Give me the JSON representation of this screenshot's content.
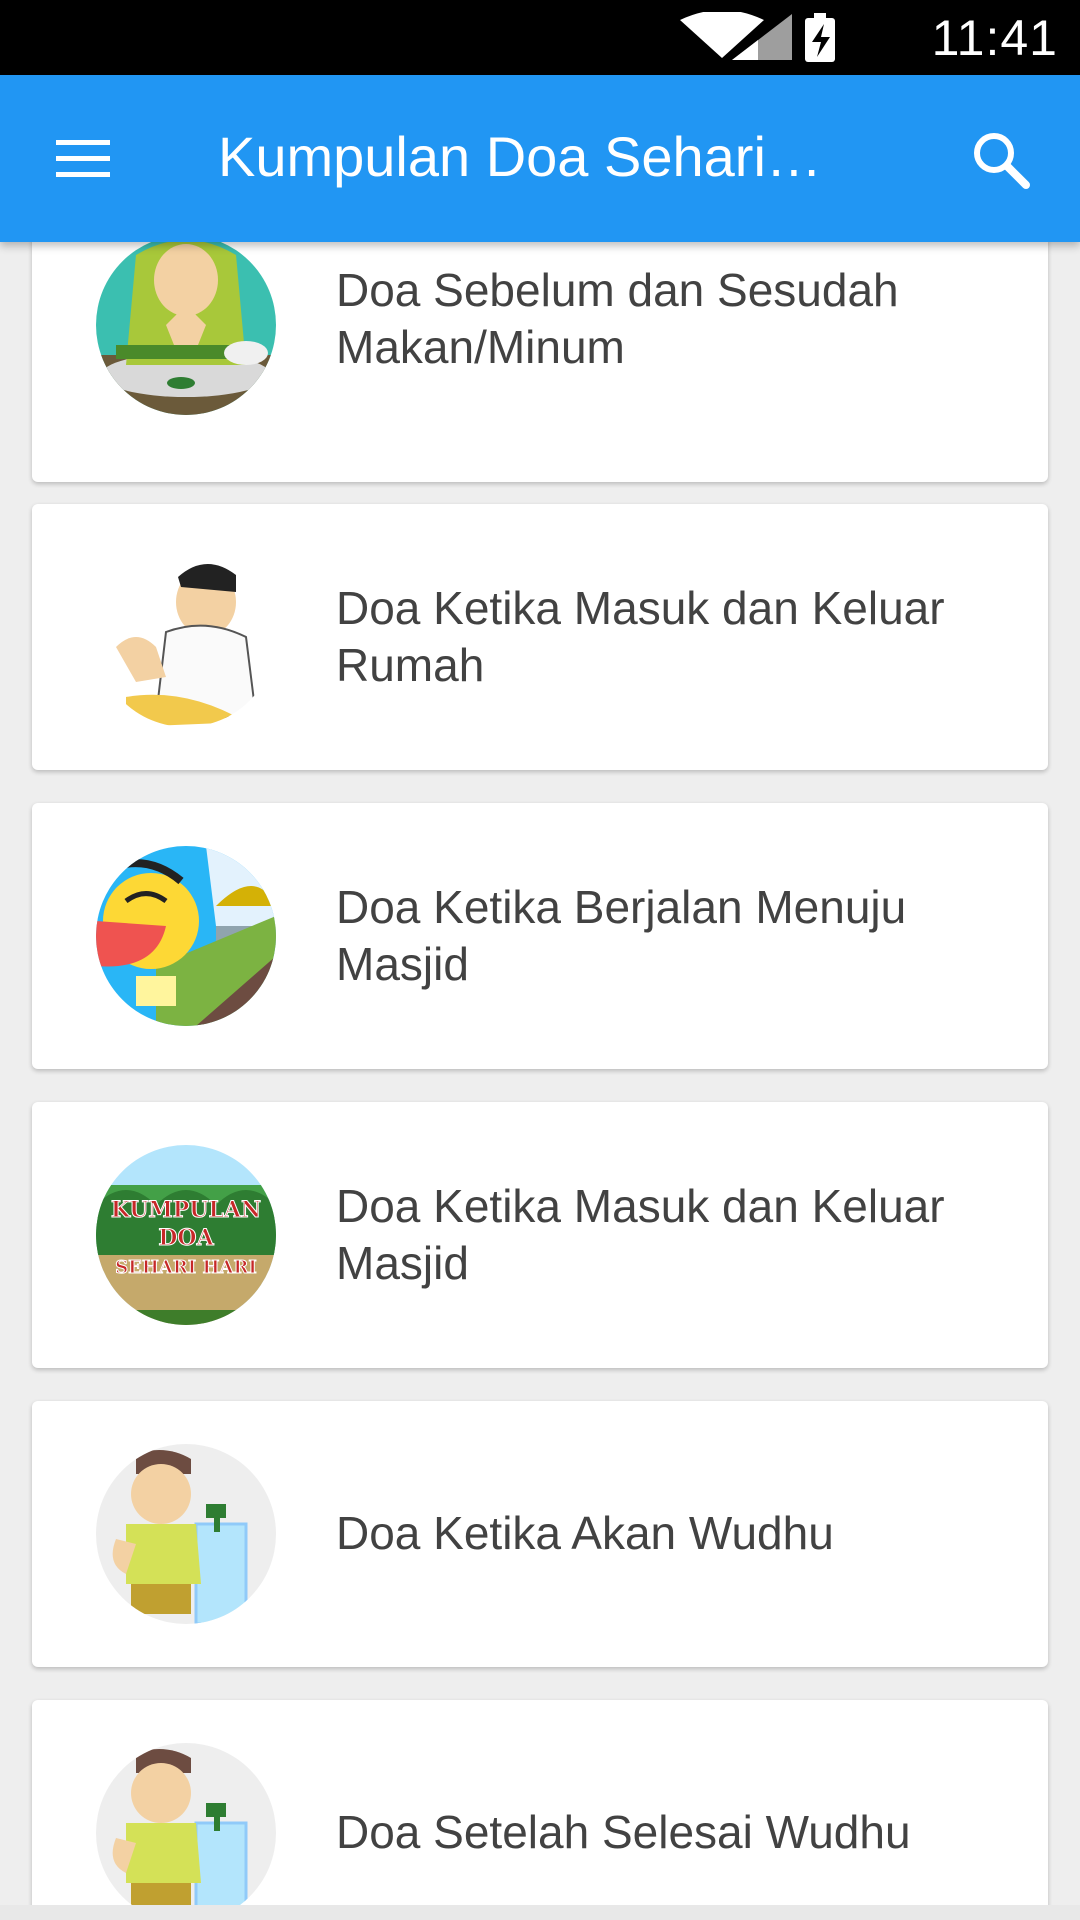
{
  "status_bar": {
    "time": "11:41",
    "icons": [
      "wifi-icon",
      "cell-signal-icon",
      "battery-charging-icon"
    ]
  },
  "app_bar": {
    "title": "Kumpulan Doa Sehari…",
    "menu_icon": "hamburger-menu-icon",
    "search_icon": "search-icon",
    "color": "#2196f3"
  },
  "items": [
    {
      "label": "Doa Sebelum dan Sesudah Makan/Minum",
      "image": "girl-praying-at-meal"
    },
    {
      "label": "Doa Ketika Masuk dan Keluar Rumah",
      "image": "man-praying"
    },
    {
      "label": "Doa Ketika Berjalan Menuju Masjid",
      "image": "child-walking-to-mosque"
    },
    {
      "label": "Doa Ketika Masuk dan Keluar Masjid",
      "image": "kumpulan-doa-logo",
      "image_text": "KUMPULAN DOA SEHARI HARI"
    },
    {
      "label": "Doa Ketika Akan Wudhu",
      "image": "boy-at-water-tap"
    },
    {
      "label": "Doa Setelah Selesai Wudhu",
      "image": "boy-at-water-tap"
    }
  ]
}
